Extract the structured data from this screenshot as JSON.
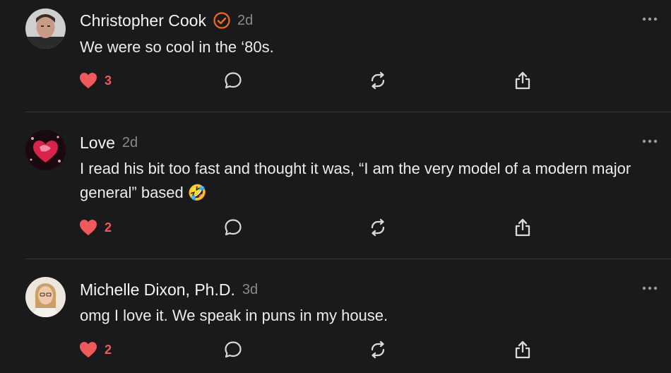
{
  "posts": [
    {
      "author": "Christopher Cook",
      "verified": true,
      "time": "2d",
      "text": "We were so cool in the ‘80s.",
      "likes": "3",
      "icons": [
        "heart-icon",
        "comment-icon",
        "repost-icon",
        "share-icon",
        "more-icon"
      ]
    },
    {
      "author": "Love",
      "verified": false,
      "time": "2d",
      "text": "I read his bit too fast and thought it was, “I am the very model of a modern major general” based 🤣",
      "likes": "2",
      "icons": [
        "heart-icon",
        "comment-icon",
        "repost-icon",
        "share-icon",
        "more-icon"
      ]
    },
    {
      "author": "Michelle Dixon, Ph.D.",
      "verified": false,
      "time": "3d",
      "text": "omg I love it. We speak in puns in my house.",
      "likes": "2",
      "icons": [
        "heart-icon",
        "comment-icon",
        "repost-icon",
        "share-icon",
        "more-icon"
      ]
    }
  ],
  "colors": {
    "background": "#1a1a1c",
    "like": "#f0595a",
    "verified": "#f26b1d",
    "icon": "#d9d9d9",
    "muted": "#8a8a8d"
  }
}
